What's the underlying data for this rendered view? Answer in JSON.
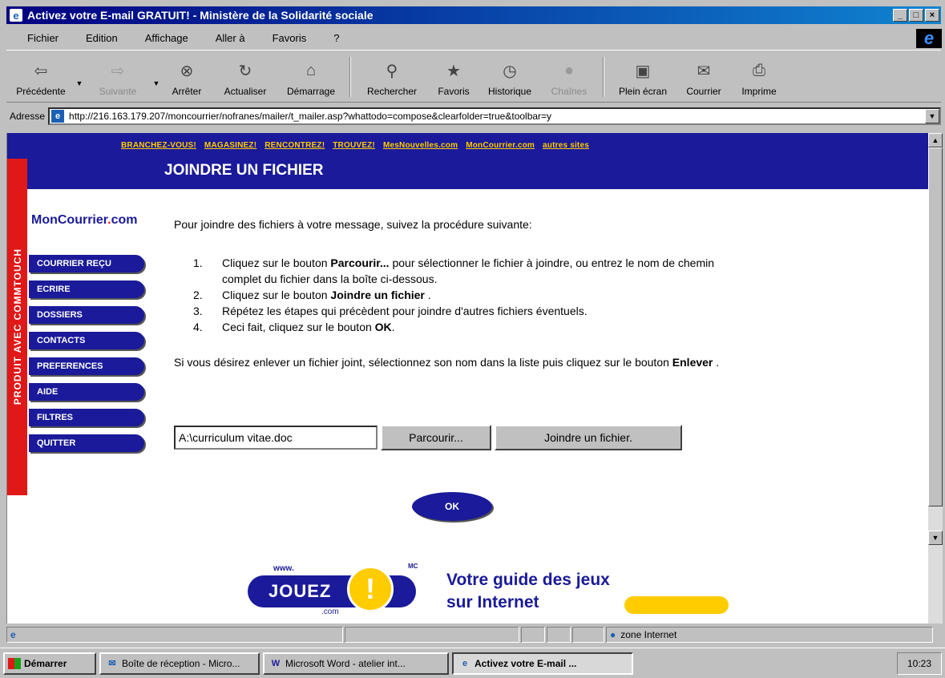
{
  "window": {
    "title": "Activez votre E-mail GRATUIT! - Ministère de la Solidarité sociale",
    "controls": [
      "_",
      "□",
      "×"
    ]
  },
  "menu": [
    "Fichier",
    "Edition",
    "Affichage",
    "Aller à",
    "Favoris",
    "?"
  ],
  "toolbar": {
    "buttons": [
      {
        "label": "Précédente",
        "icon": "back-arrow"
      },
      {
        "label": "Suivante",
        "icon": "forward-arrow"
      },
      {
        "label": "Arrêter",
        "icon": "stop"
      },
      {
        "label": "Actualiser",
        "icon": "refresh"
      },
      {
        "label": "Démarrage",
        "icon": "home"
      },
      {
        "label": "Rechercher",
        "icon": "search"
      },
      {
        "label": "Favoris",
        "icon": "favorites"
      },
      {
        "label": "Historique",
        "icon": "history"
      },
      {
        "label": "Chaînes",
        "icon": "channels"
      },
      {
        "label": "Plein écran",
        "icon": "fullscreen"
      },
      {
        "label": "Courrier",
        "icon": "mail"
      },
      {
        "label": "Imprime",
        "icon": "print"
      }
    ]
  },
  "address": {
    "label": "Adresse",
    "url": "http://216.163.179.207/moncourrier/nofranes/mailer/t_mailer.asp?whattodo=compose&clearfolder=true&toolbar=y"
  },
  "page": {
    "top_links": [
      "BRANCHEZ-VOUS!",
      "MAGASINEZ!",
      "RENCONTREZ!",
      "TROUVEZ!",
      "MesNouvelles.com",
      "MonCourrier.com",
      "autres sites"
    ],
    "title": "JOINDRE UN FICHIER",
    "side_text": "PRODUIT AVEC COMMTOUCH",
    "brand": {
      "name": "MonCourrier",
      "dot": ".",
      "suffix": "com"
    },
    "nav": [
      "COURRIER REÇU",
      "ECRIRE",
      "DOSSIERS",
      "CONTACTS",
      "PREFERENCES",
      "AIDE",
      "FILTRES",
      "QUITTER"
    ],
    "intro": "Pour joindre des fichiers à votre message, suivez la procédure suivante:",
    "steps": [
      {
        "num": "1.",
        "pre": "Cliquez sur le bouton ",
        "bold": "Parcourir...",
        "post": " pour sélectionner le fichier à joindre, ou entrez le nom de chemin complet du fichier dans la boîte ci-dessous."
      },
      {
        "num": "2.",
        "pre": "Cliquez sur le bouton ",
        "bold": "Joindre un fichier",
        "post": " ."
      },
      {
        "num": "3.",
        "pre": "Répétez les étapes qui précèdent pour joindre d'autres fichiers éventuels.",
        "bold": "",
        "post": ""
      },
      {
        "num": "4.",
        "pre": "Ceci fait, cliquez sur le bouton ",
        "bold": "OK",
        "post": "."
      }
    ],
    "remove": {
      "pre": "Si vous désirez enlever un fichier joint, sélectionnez son nom dans la liste puis cliquez sur le bouton ",
      "bold": "Enlever",
      "post": " ."
    },
    "file_value": "A:\\curriculum vitae.doc",
    "browse_label": "Parcourir...",
    "attach_label": "Joindre un fichier.",
    "ok_label": "OK",
    "banner": {
      "www": "www.",
      "jouez": "JOUEZ",
      "excl": "!",
      "mc": "MC",
      "com": ".com",
      "line1": "Votre guide des jeux",
      "line2": "sur Internet"
    }
  },
  "status": {
    "zone": "zone Internet"
  },
  "taskbar": {
    "start": "Démarrer",
    "tasks": [
      {
        "label": "Boîte de réception - Micro...",
        "active": false
      },
      {
        "label": "Microsoft Word - atelier int...",
        "active": false
      },
      {
        "label": "Activez votre E-mail ...",
        "active": true
      }
    ],
    "clock": "10:23"
  },
  "colors": {
    "header_blue": "#1a1a9a",
    "link_yellow": "#ffcc00",
    "side_red": "#e01818"
  }
}
